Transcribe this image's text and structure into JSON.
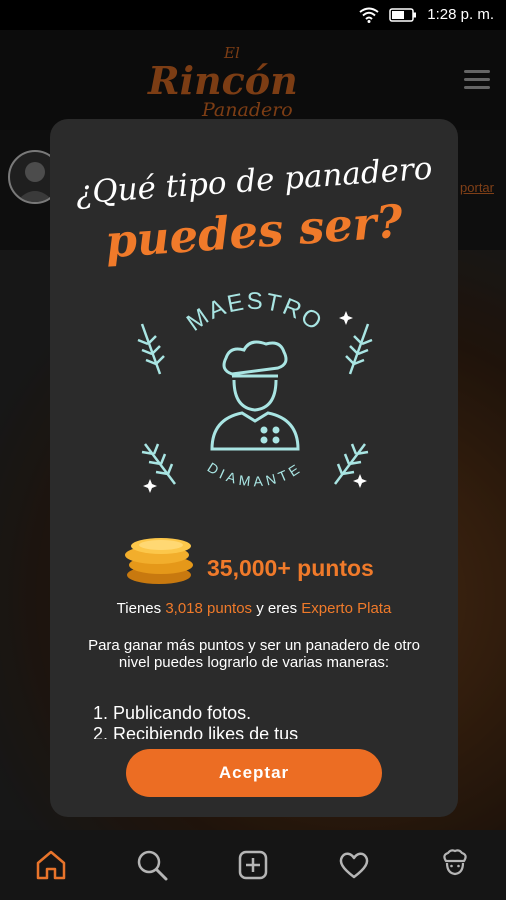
{
  "status_bar": {
    "time": "1:28 p. m."
  },
  "header": {
    "logo_text": {
      "line1": "El",
      "line2": "Rincón",
      "line3": "Panadero"
    },
    "report_link": "portar"
  },
  "modal": {
    "title_line1": "¿Qué tipo de panadero",
    "title_line2": "puedes ser?",
    "badge": {
      "top_text": "MAESTRO",
      "bottom_text": "DIAMANTE"
    },
    "points_target": "35,000+ puntos",
    "status": {
      "prefix": "Tienes ",
      "points": "3,018 puntos",
      "middle": " y eres ",
      "level": "Experto Plata"
    },
    "description": "Para ganar más puntos y ser un panadero de otro nivel puedes lograrlo de varias maneras:",
    "list": [
      "1. Publicando fotos.",
      "2. Recibiendo likes de tus"
    ],
    "accept_button": "Aceptar"
  },
  "colors": {
    "accent": "#f07a2a",
    "badge": "#a9e5e3",
    "modal_bg": "#2b2b2b"
  },
  "nav": {
    "icons": [
      "home-icon",
      "search-icon",
      "add-icon",
      "heart-icon",
      "profile-chef-icon"
    ],
    "active": "home-icon"
  }
}
